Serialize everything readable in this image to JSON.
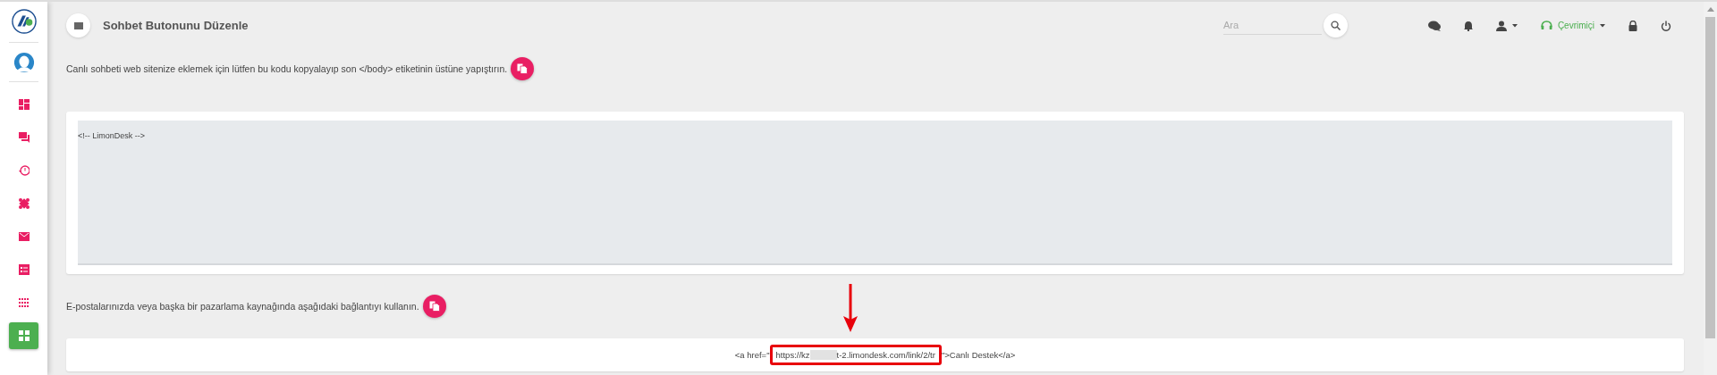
{
  "sidebar": {
    "items": [
      {
        "selected": false
      },
      {
        "selected": false
      },
      {
        "selected": false
      },
      {
        "selected": false
      },
      {
        "selected": false
      },
      {
        "selected": false
      },
      {
        "selected": false
      },
      {
        "selected": true
      }
    ]
  },
  "header": {
    "title": "Sohbet Butonunu Düzenle",
    "search": {
      "placeholder": "Ara"
    },
    "status": {
      "label": "Çevrimiçi"
    }
  },
  "sections": [
    {
      "kind": "code_block",
      "instruction": "Canlı sohbeti web sitenize eklemek için lütfen bu kodu kopyalayıp son </body> etiketinin üstüne yapıştırın.",
      "code": "<!-- LimonDesk -->"
    },
    {
      "kind": "link",
      "instruction": "E-postalarınızda veya başka bir pazarlama kaynağında aşağıdaki bağlantıyı kullanın.",
      "code_before": "<a href=\"",
      "url_start": "https://kz",
      "url_end": "t-2.limondesk.com/link/2/tr",
      "code_after": "\">Canlı Destek</a>"
    }
  ]
}
